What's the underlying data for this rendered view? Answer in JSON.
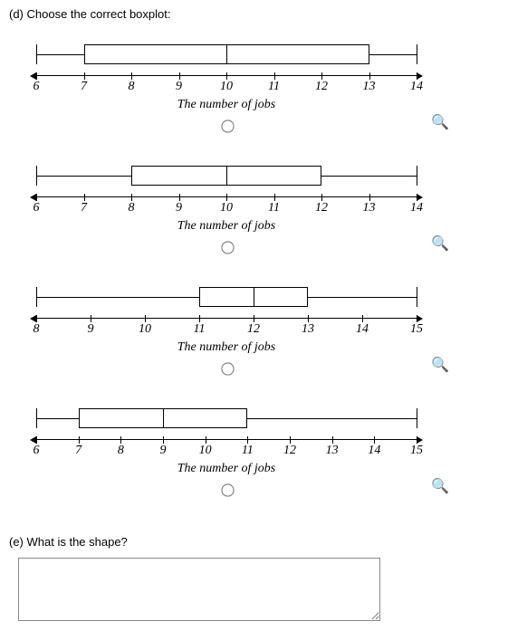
{
  "question_d": "(d) Choose the correct boxplot:",
  "question_e": "(e) What is the shape?",
  "axis_title": "The number of jobs",
  "search_icon": "🔍",
  "options": [
    {
      "axis_min": 6,
      "axis_max": 14,
      "ticks": [
        6,
        7,
        8,
        9,
        10,
        11,
        12,
        13,
        14
      ],
      "box": {
        "min": 6,
        "q1": 7,
        "median": 10,
        "q3": 13,
        "max": 14
      }
    },
    {
      "axis_min": 6,
      "axis_max": 14,
      "ticks": [
        6,
        7,
        8,
        9,
        10,
        11,
        12,
        13,
        14
      ],
      "box": {
        "min": 6,
        "q1": 8,
        "median": 10,
        "q3": 12,
        "max": 14
      }
    },
    {
      "axis_min": 8,
      "axis_max": 15,
      "ticks": [
        8,
        9,
        10,
        11,
        12,
        13,
        14,
        15
      ],
      "box": {
        "min": 8,
        "q1": 11,
        "median": 12,
        "q3": 13,
        "max": 15
      }
    },
    {
      "axis_min": 6,
      "axis_max": 15,
      "ticks": [
        6,
        7,
        8,
        9,
        10,
        11,
        12,
        13,
        14,
        15
      ],
      "box": {
        "min": 6,
        "q1": 7,
        "median": 9,
        "q3": 11,
        "max": 15
      }
    }
  ],
  "chart_data": [
    {
      "type": "boxplot",
      "title": "",
      "xlabel": "The number of jobs",
      "min": 6,
      "q1": 7,
      "median": 10,
      "q3": 13,
      "max": 14,
      "xlim": [
        6,
        14
      ],
      "ticks": [
        6,
        7,
        8,
        9,
        10,
        11,
        12,
        13,
        14
      ]
    },
    {
      "type": "boxplot",
      "title": "",
      "xlabel": "The number of jobs",
      "min": 6,
      "q1": 8,
      "median": 10,
      "q3": 12,
      "max": 14,
      "xlim": [
        6,
        14
      ],
      "ticks": [
        6,
        7,
        8,
        9,
        10,
        11,
        12,
        13,
        14
      ]
    },
    {
      "type": "boxplot",
      "title": "",
      "xlabel": "The number of jobs",
      "min": 8,
      "q1": 11,
      "median": 12,
      "q3": 13,
      "max": 15,
      "xlim": [
        8,
        15
      ],
      "ticks": [
        8,
        9,
        10,
        11,
        12,
        13,
        14,
        15
      ]
    },
    {
      "type": "boxplot",
      "title": "",
      "xlabel": "The number of jobs",
      "min": 6,
      "q1": 7,
      "median": 9,
      "q3": 11,
      "max": 15,
      "xlim": [
        6,
        15
      ],
      "ticks": [
        6,
        7,
        8,
        9,
        10,
        11,
        12,
        13,
        14,
        15
      ]
    }
  ],
  "answer_value": ""
}
